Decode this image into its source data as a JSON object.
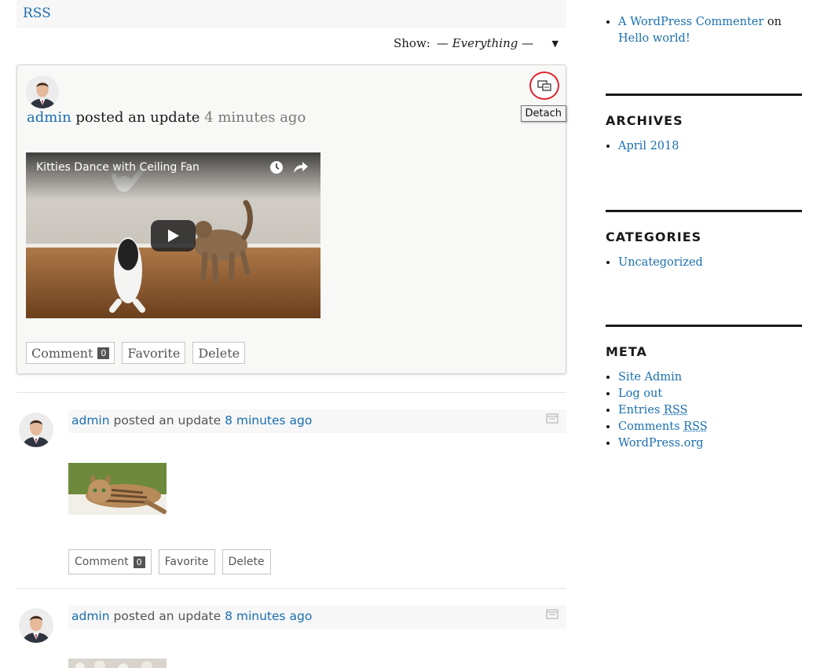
{
  "rss_bar": {
    "label": "RSS"
  },
  "filter": {
    "label": "Show:",
    "value": "— Everything —"
  },
  "activities": [
    {
      "user": "admin",
      "action": "posted an update",
      "time": "4 minutes ago",
      "tooltip": "Detach",
      "video": {
        "title": "Kitties Dance with Ceiling Fan"
      },
      "buttons": {
        "comment": "Comment",
        "comment_count": "0",
        "favorite": "Favorite",
        "delete": "Delete"
      }
    },
    {
      "user": "admin",
      "action": "posted an update",
      "time": "8 minutes ago",
      "buttons": {
        "comment": "Comment",
        "comment_count": "0",
        "favorite": "Favorite",
        "delete": "Delete"
      }
    },
    {
      "user": "admin",
      "action": "posted an update",
      "time": "8 minutes ago"
    }
  ],
  "sidebar": {
    "recent_comment": {
      "author": "A WordPress Commenter",
      "on": "on",
      "post": "Hello world!"
    },
    "archives": {
      "title": "ARCHIVES",
      "items": [
        "April 2018"
      ]
    },
    "categories": {
      "title": "CATEGORIES",
      "items": [
        "Uncategorized"
      ]
    },
    "meta": {
      "title": "META",
      "items": [
        "Site Admin",
        "Log out"
      ],
      "entries": "Entries",
      "comments": "Comments",
      "rss": "RSS",
      "wporg": "WordPress.org"
    }
  },
  "icons": {
    "detach": "detach-icon",
    "clock": "clock-icon",
    "share": "share-icon",
    "play": "play-icon",
    "favorite_bar": "detach-icon"
  }
}
